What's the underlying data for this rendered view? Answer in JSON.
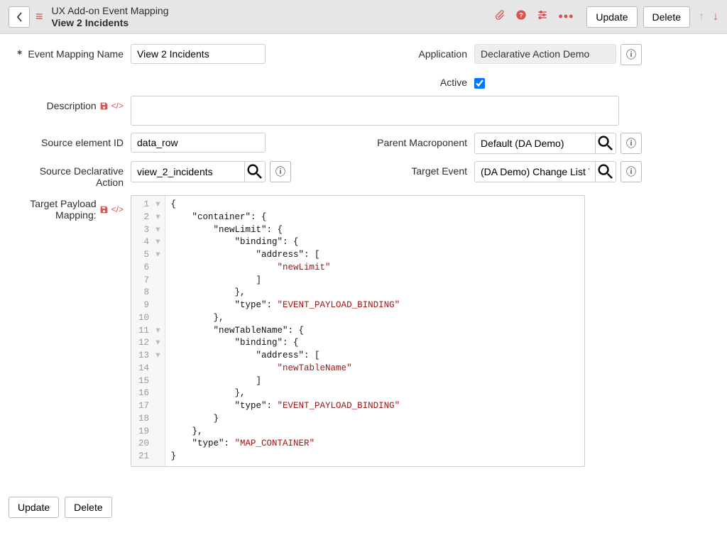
{
  "header": {
    "heading": "UX Add-on Event Mapping",
    "record_name": "View 2 Incidents",
    "actions": {
      "update": "Update",
      "delete": "Delete"
    }
  },
  "fields": {
    "event_mapping_name": {
      "label": "Event Mapping Name",
      "value": "View 2 Incidents"
    },
    "application": {
      "label": "Application",
      "value": "Declarative Action Demo"
    },
    "active": {
      "label": "Active",
      "checked": true
    },
    "description": {
      "label": "Description",
      "value": ""
    },
    "source_element_id": {
      "label": "Source element ID",
      "value": "data_row"
    },
    "parent_macroponent": {
      "label": "Parent Macroponent",
      "value": "Default (DA Demo)"
    },
    "source_declarative_action": {
      "label": "Source Declarative Action",
      "value": "view_2_incidents"
    },
    "target_event": {
      "label": "Target Event",
      "value": "(DA Demo) Change List Table a"
    },
    "target_payload_mapping": {
      "label": "Target Payload Mapping:"
    }
  },
  "footer": {
    "update": "Update",
    "delete": "Delete"
  },
  "code_lines": [
    [
      1,
      true,
      "{"
    ],
    [
      2,
      true,
      "    \"container\": {"
    ],
    [
      3,
      true,
      "        \"newLimit\": {"
    ],
    [
      4,
      true,
      "            \"binding\": {"
    ],
    [
      5,
      true,
      "                \"address\": ["
    ],
    [
      6,
      false,
      "                    \"newLimit\""
    ],
    [
      7,
      false,
      "                ]"
    ],
    [
      8,
      false,
      "            },"
    ],
    [
      9,
      false,
      "            \"type\": \"EVENT_PAYLOAD_BINDING\""
    ],
    [
      10,
      false,
      "        },"
    ],
    [
      11,
      true,
      "        \"newTableName\": {"
    ],
    [
      12,
      true,
      "            \"binding\": {"
    ],
    [
      13,
      true,
      "                \"address\": ["
    ],
    [
      14,
      false,
      "                    \"newTableName\""
    ],
    [
      15,
      false,
      "                ]"
    ],
    [
      16,
      false,
      "            },"
    ],
    [
      17,
      false,
      "            \"type\": \"EVENT_PAYLOAD_BINDING\""
    ],
    [
      18,
      false,
      "        }"
    ],
    [
      19,
      false,
      "    },"
    ],
    [
      20,
      false,
      "    \"type\": \"MAP_CONTAINER\""
    ],
    [
      21,
      false,
      "}"
    ]
  ]
}
